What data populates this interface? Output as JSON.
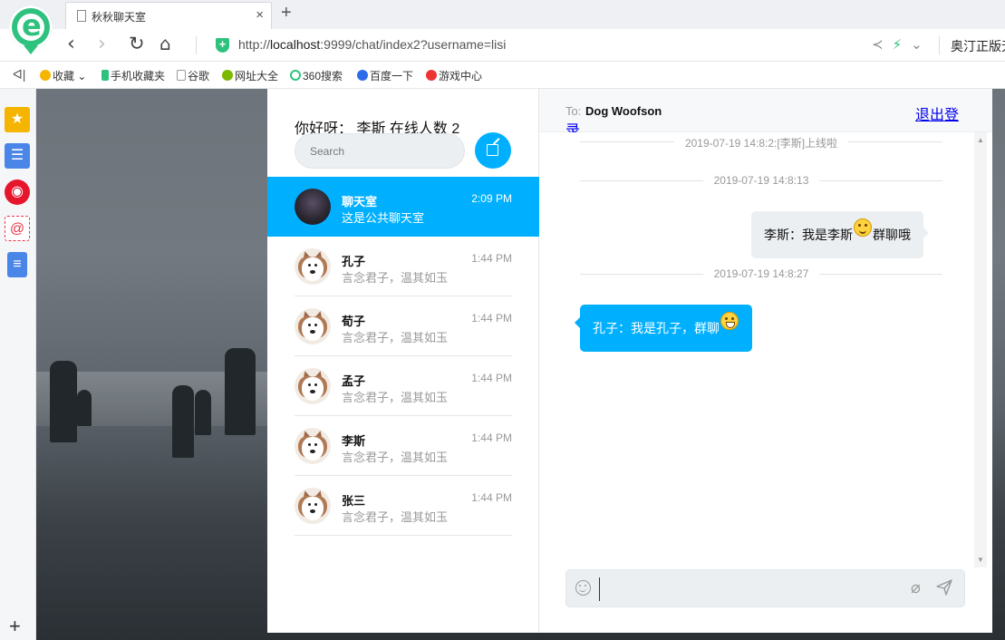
{
  "browser": {
    "tab_title": "秋秋聊天室",
    "tab_close": "×",
    "new_tab": "+",
    "url_prefix": "http://",
    "url_host": "localhost",
    "url_rest": ":9999/chat/index2?username=lisi",
    "extension_label": "奥汀正版无",
    "bookmarks_toggle": "ᐊ|",
    "bookmarks": [
      {
        "label": "收藏",
        "icon": "star-icon",
        "color": "#f5b400"
      },
      {
        "label": "手机收藏夹",
        "icon": "phone-icon",
        "color": "#2ec27e"
      },
      {
        "label": "谷歌",
        "icon": "page-icon",
        "color": "#bbbbbb"
      },
      {
        "label": "网址大全",
        "icon": "globe-icon",
        "color": "#7cb800"
      },
      {
        "label": "360搜索",
        "icon": "circle-icon",
        "color": "#2ec27e"
      },
      {
        "label": "百度一下",
        "icon": "paw-icon",
        "color": "#2b6de8"
      },
      {
        "label": "游戏中心",
        "icon": "game-icon",
        "color": "#e33"
      }
    ]
  },
  "sidebar": [
    {
      "icon": "favorites-star-icon",
      "color": "#f5b400"
    },
    {
      "icon": "news-icon",
      "color": "#4a86e8"
    },
    {
      "icon": "weibo-icon",
      "color": "#e6162d"
    },
    {
      "icon": "mail-icon",
      "color": "#e34"
    },
    {
      "icon": "document-icon",
      "color": "#4a86e8"
    }
  ],
  "people_panel": {
    "greeting": "你好呀： 李斯   在线人数 2",
    "search_placeholder": "Search",
    "list": [
      {
        "name": "聊天室",
        "time": "2:09 PM",
        "preview": "这是公共聊天室",
        "active": true,
        "avatar": "room"
      },
      {
        "name": "孔子",
        "time": "1:44 PM",
        "preview": "言念君子，温其如玉",
        "active": false,
        "avatar": "dog"
      },
      {
        "name": "荀子",
        "time": "1:44 PM",
        "preview": "言念君子，温其如玉",
        "active": false,
        "avatar": "dog"
      },
      {
        "name": "孟子",
        "time": "1:44 PM",
        "preview": "言念君子，温其如玉",
        "active": false,
        "avatar": "dog"
      },
      {
        "name": "李斯",
        "time": "1:44 PM",
        "preview": "言念君子，温其如玉",
        "active": false,
        "avatar": "dog"
      },
      {
        "name": "张三",
        "time": "1:44 PM",
        "preview": "言念君子，温其如玉",
        "active": false,
        "avatar": "dog"
      }
    ]
  },
  "chat_panel": {
    "to_label": "To:",
    "to_name": "Dog Woofson",
    "logout_line1": "退出登",
    "logout_line2": "录",
    "messages": [
      {
        "type": "notice",
        "text": "2019-07-19 14:8:2:[李斯]上线啦"
      },
      {
        "type": "time",
        "text": "2019-07-19 14:8:13"
      },
      {
        "type": "me",
        "text_before": "李斯：我是李斯",
        "text_after": "群聊哦",
        "emoji": "smile-emoji-icon"
      },
      {
        "type": "time",
        "text": "2019-07-19 14:8:27"
      },
      {
        "type": "you",
        "text_before": "孔子：我是孔子，群聊",
        "text_after": "",
        "emoji": "grin-emoji-icon"
      }
    ],
    "input_value": ""
  }
}
